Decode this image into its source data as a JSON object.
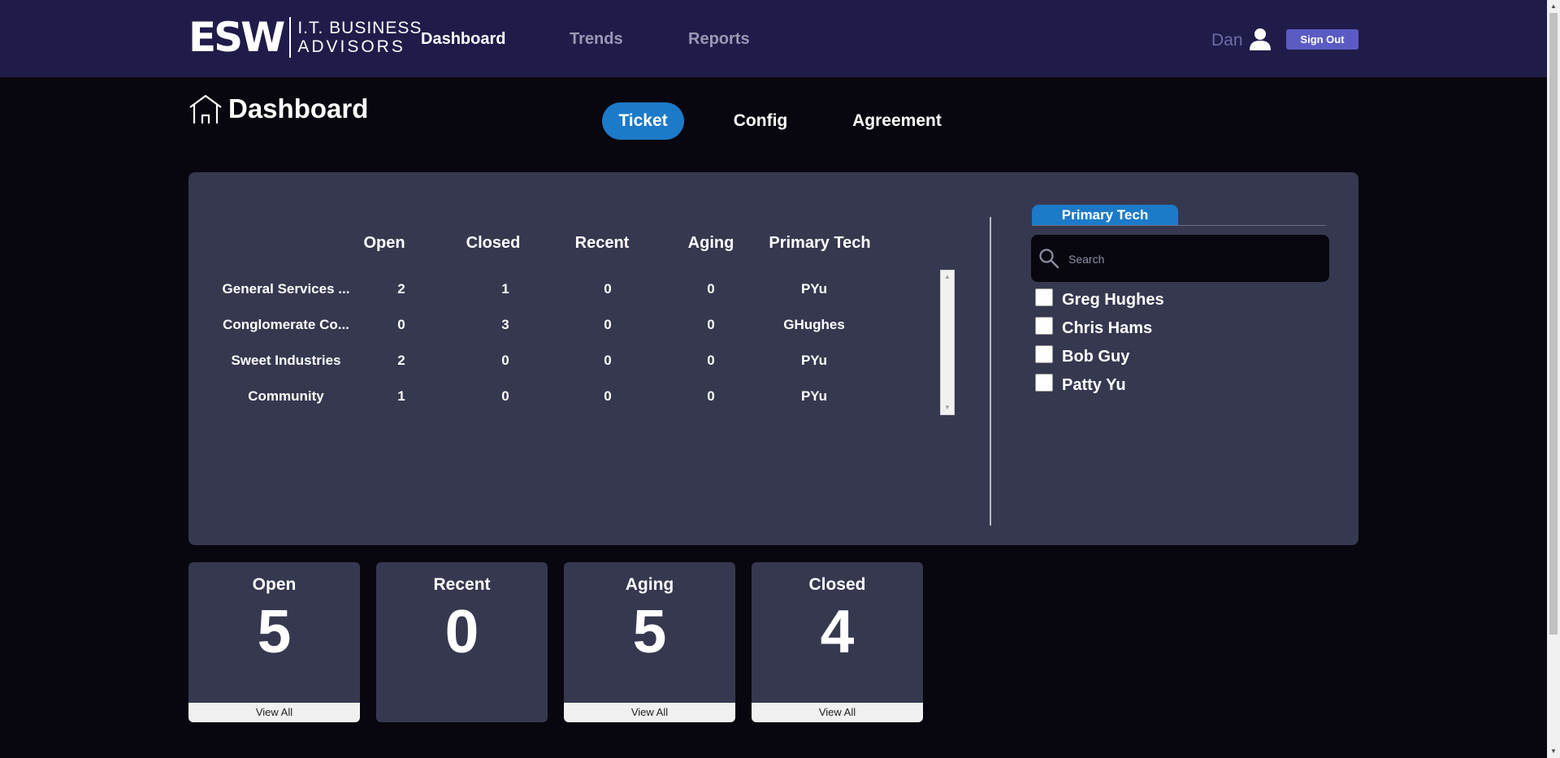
{
  "header": {
    "logo": {
      "mark": "ESW",
      "line1": "I.T. BUSINESS",
      "line2": "ADVISORS"
    },
    "nav": [
      "Dashboard",
      "Trends",
      "Reports"
    ],
    "active_nav": "Dashboard",
    "user_name": "Dan",
    "sign_out_label": "Sign Out",
    "colors": {
      "bar": "#201c4a",
      "sign_out": "#5b5bc4"
    }
  },
  "page": {
    "title": "Dashboard",
    "tabs": [
      "Ticket",
      "Config",
      "Agreement"
    ],
    "active_tab": "Ticket",
    "accent_color": "#1c7ac9"
  },
  "ticket_table": {
    "columns": [
      "Open",
      "Closed",
      "Recent",
      "Aging",
      "Primary Tech"
    ],
    "rows": [
      {
        "name": "General Services ...",
        "open": "2",
        "closed": "1",
        "recent": "0",
        "aging": "0",
        "tech": "PYu"
      },
      {
        "name": "Conglomerate Co...",
        "open": "0",
        "closed": "3",
        "recent": "0",
        "aging": "0",
        "tech": "GHughes"
      },
      {
        "name": "Sweet Industries",
        "open": "2",
        "closed": "0",
        "recent": "0",
        "aging": "0",
        "tech": "PYu"
      },
      {
        "name": "Community",
        "open": "1",
        "closed": "0",
        "recent": "0",
        "aging": "0",
        "tech": "PYu"
      }
    ]
  },
  "primary_tech_filter": {
    "tab_label": "Primary Tech",
    "search_placeholder": "Search",
    "techs": [
      "Greg Hughes",
      "Chris Hams",
      "Bob Guy",
      "Patty Yu"
    ]
  },
  "summary_cards": [
    {
      "title": "Open",
      "value": "5",
      "button": "View All"
    },
    {
      "title": "Recent",
      "value": "0"
    },
    {
      "title": "Aging",
      "value": "5",
      "button": "View All"
    },
    {
      "title": "Closed",
      "value": "4",
      "button": "View All"
    }
  ]
}
